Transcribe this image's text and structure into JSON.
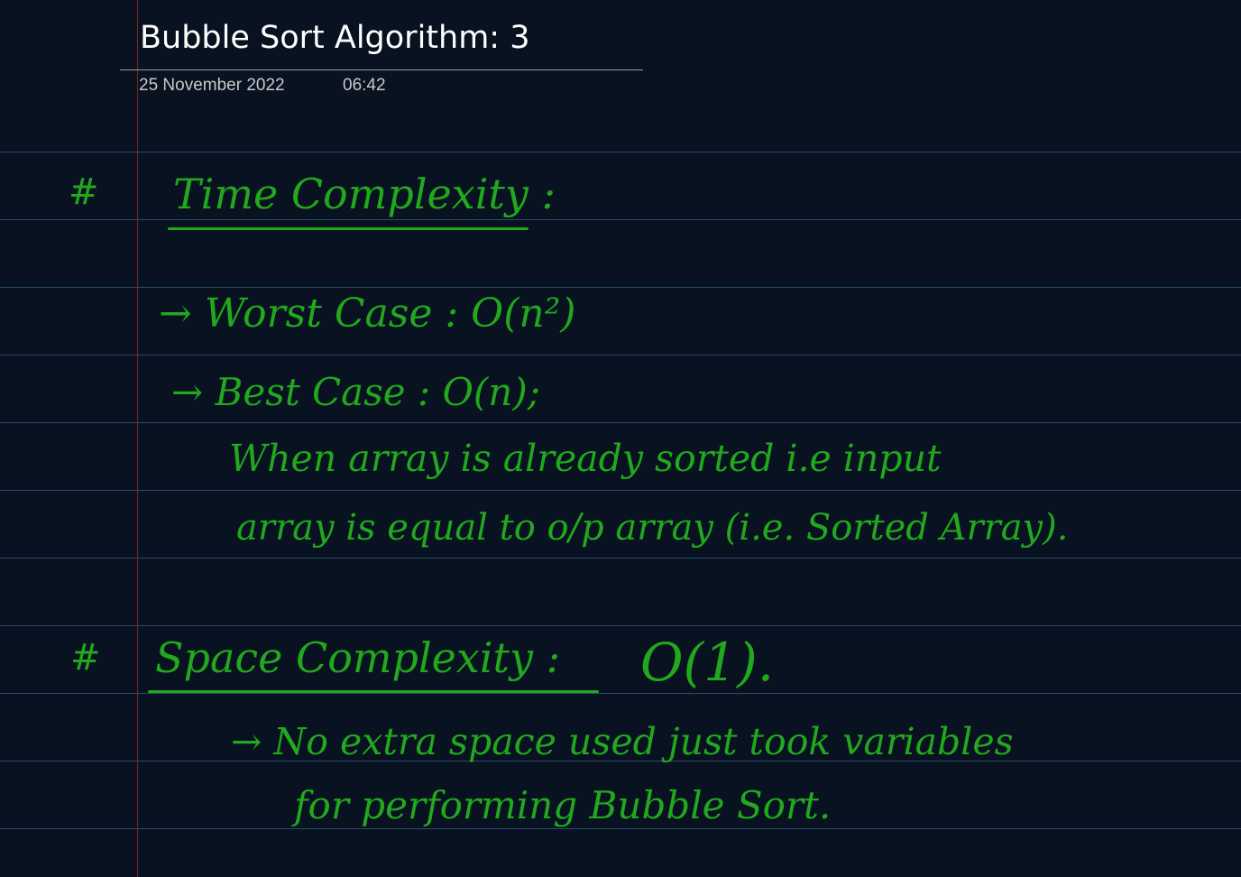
{
  "note": {
    "title": "Bubble Sort Algorithm: 3",
    "date": "25 November 2022",
    "time": "06:42"
  },
  "handwriting": {
    "time_heading_bullet": "#",
    "time_heading": "Time Complexity :",
    "worst_case": "→ Worst Case : O(n²)",
    "best_case": "→ Best Case : O(n);",
    "best_case_note_1": "When array is already sorted i.e input",
    "best_case_note_2": "array is equal to o/p array (i.e. Sorted Array).",
    "space_heading_bullet": "#",
    "space_heading": "Space Complexity :",
    "space_value": "O(1).",
    "space_note_1": "→ No extra space used just took variables",
    "space_note_2": "for performing Bubble Sort."
  },
  "colors": {
    "background": "#081220",
    "rule_line": "#2a4c6a",
    "margin_line": "#8a1e24",
    "ink": "#22a81e",
    "title_text": "#ffffff",
    "meta_text": "#c9c9c9"
  }
}
